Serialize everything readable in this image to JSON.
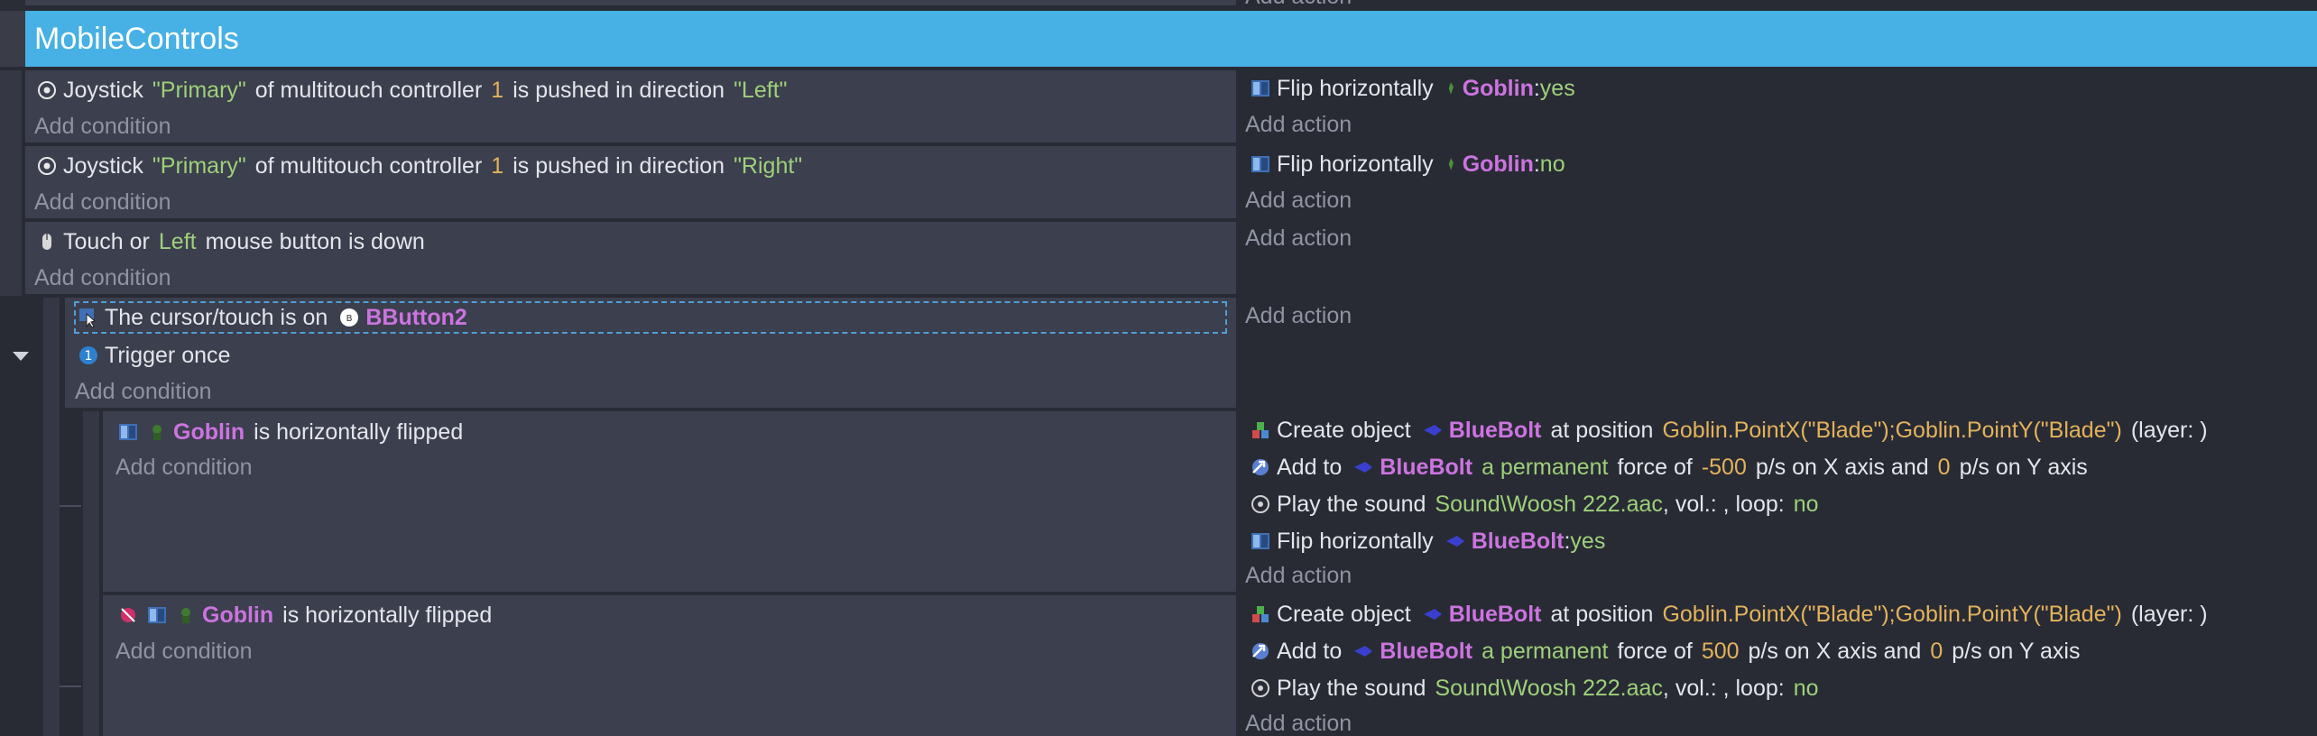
{
  "group": {
    "title": "MobileControls"
  },
  "add_condition": "Add condition",
  "add_action": "Add action",
  "top_add_action": "Add action",
  "ev1": {
    "c": [
      "Joystick",
      "\"Primary\"",
      "of multitouch controller",
      "1",
      "is pushed in direction",
      "\"Left\""
    ],
    "a": [
      "Flip horizontally",
      "Goblin",
      ": ",
      "yes"
    ]
  },
  "ev2": {
    "c": [
      "Joystick",
      "\"Primary\"",
      "of multitouch controller",
      "1",
      "is pushed in direction",
      "\"Right\""
    ],
    "a": [
      "Flip horizontally",
      "Goblin",
      ": ",
      "no"
    ]
  },
  "ev3": {
    "c": [
      "Touch or",
      "Left",
      "mouse button is down"
    ]
  },
  "ev4": {
    "c1": [
      "The cursor/touch is on",
      "BButton2"
    ],
    "c2": "Trigger once"
  },
  "ev5": {
    "c": [
      "Goblin",
      "is horizontally flipped"
    ],
    "a1": [
      "Create object",
      "BlueBolt",
      "at position",
      "Goblin.PointX(\"Blade\");Goblin.PointY(\"Blade\")",
      "(layer:  )"
    ],
    "a2": [
      "Add to",
      "BlueBolt",
      "a permanent",
      "force of",
      "-500",
      "p/s on X axis and",
      "0",
      "p/s on Y axis"
    ],
    "a3": [
      "Play the sound",
      "Sound\\Woosh 222.aac",
      ", vol.: , loop:",
      "no"
    ],
    "a4": [
      "Flip horizontally",
      "BlueBolt",
      ": ",
      "yes"
    ]
  },
  "ev6": {
    "c": [
      "Goblin",
      "is horizontally flipped"
    ],
    "a1": [
      "Create object",
      "BlueBolt",
      "at position",
      "Goblin.PointX(\"Blade\");Goblin.PointY(\"Blade\")",
      "(layer:  )"
    ],
    "a2": [
      "Add to",
      "BlueBolt",
      "a permanent",
      "force of",
      "500",
      "p/s on X axis and",
      "0",
      "p/s on Y axis"
    ],
    "a3": [
      "Play the sound",
      "Sound\\Woosh 222.aac",
      ", vol.: , loop:",
      "no"
    ]
  },
  "colors": {
    "header": "#47b0e4",
    "condition_bg": "#3c3f4d",
    "object": "#cc74e0",
    "string": "#9ed07a",
    "number": "#e3b25b"
  }
}
